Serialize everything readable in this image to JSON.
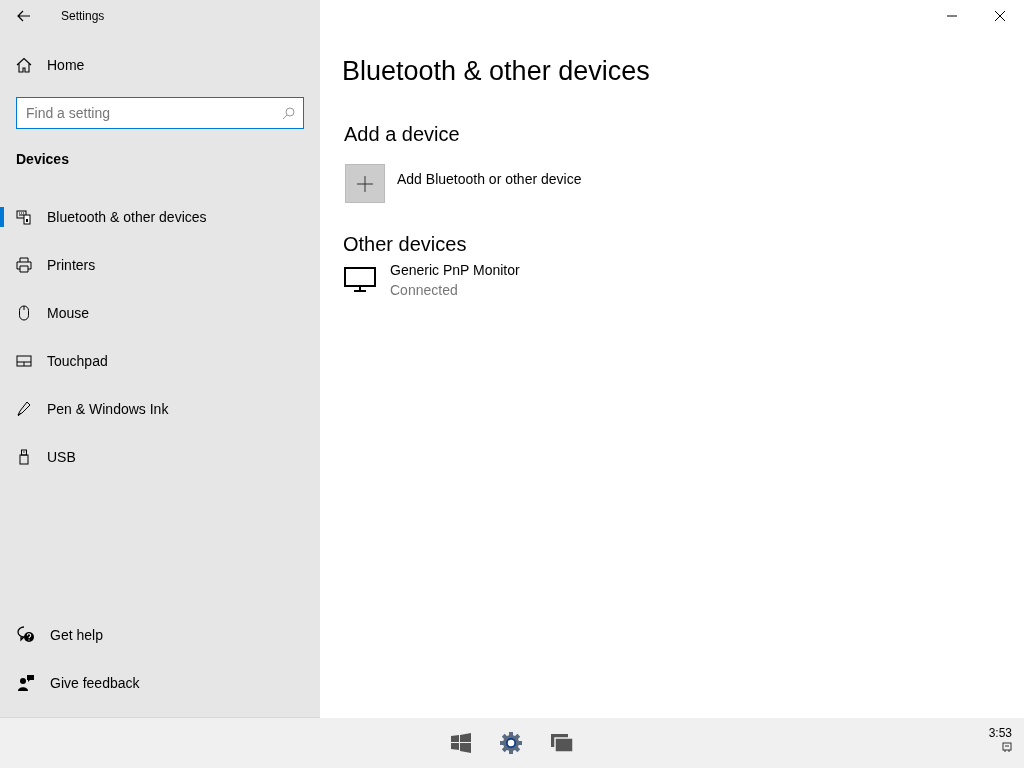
{
  "window": {
    "title": "Settings"
  },
  "sidebar": {
    "home": "Home",
    "search": {
      "placeholder": "Find a setting"
    },
    "section": "Devices",
    "items": [
      {
        "label": "Bluetooth & other devices",
        "selected": true
      },
      {
        "label": "Printers",
        "selected": false
      },
      {
        "label": "Mouse",
        "selected": false
      },
      {
        "label": "Touchpad",
        "selected": false
      },
      {
        "label": "Pen & Windows Ink",
        "selected": false
      },
      {
        "label": "USB",
        "selected": false
      }
    ],
    "footer": [
      "Get help",
      "Give feedback"
    ]
  },
  "main": {
    "title": "Bluetooth & other devices",
    "add_heading": "Add a device",
    "add_button": "Add Bluetooth or other device",
    "other_heading": "Other devices",
    "devices": [
      {
        "name": "Generic PnP Monitor",
        "status": "Connected"
      }
    ]
  },
  "taskbar": {
    "clock": "3:53"
  }
}
